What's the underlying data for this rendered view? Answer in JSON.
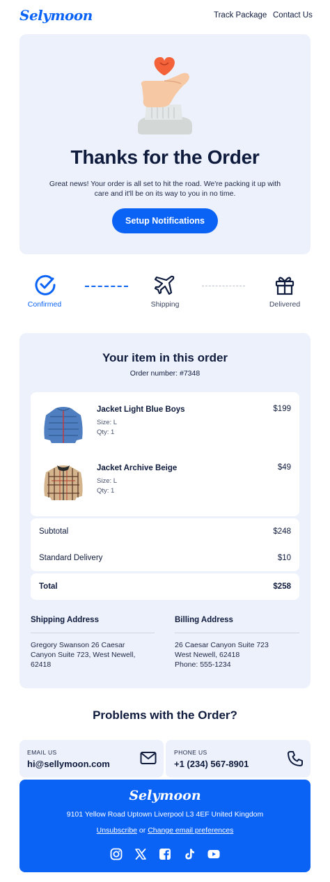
{
  "header": {
    "logo": "Selymoon",
    "nav": [
      "Track Package",
      "Contact Us"
    ]
  },
  "hero": {
    "title": "Thanks for the Order",
    "text": "Great news! Your order is all set to hit the road. We're packing it up with care and it'll be on its way to you in no time.",
    "button": "Setup Notifications"
  },
  "steps": [
    {
      "label": "Confirmed",
      "icon": "check-circle-icon",
      "active": true
    },
    {
      "label": "Shipping",
      "icon": "airplane-icon",
      "active": false
    },
    {
      "label": "Delivered",
      "icon": "gift-icon",
      "active": false
    }
  ],
  "order": {
    "title": "Your item in this order",
    "number": "Order number: #7348",
    "items": [
      {
        "name": "Jacket Light Blue Boys",
        "size": "Size: L",
        "qty": "Qty: 1",
        "price": "$199",
        "image": "blue-puffer-jacket"
      },
      {
        "name": "Jacket Archive Beige",
        "size": "Size: L",
        "qty": "Qty: 1",
        "price": "$49",
        "image": "beige-check-jacket"
      }
    ],
    "subtotal_label": "Subtotal",
    "subtotal": "$248",
    "delivery_label": "Standard Delivery",
    "delivery": "$10",
    "total_label": "Total",
    "total": "$258"
  },
  "shipping": {
    "heading": "Shipping Address",
    "lines": [
      "Gregory Swanson 26 Caesar",
      "Canyon Suite 723, West Newell,",
      "62418"
    ]
  },
  "billing": {
    "heading": "Billing Address",
    "lines": [
      "26 Caesar Canyon Suite 723",
      "West Newell, 62418",
      "Phone: 555-1234"
    ]
  },
  "problems": {
    "title": "Problems with the Order?",
    "email_label": "EMAIL US",
    "email": "hi@sellymoon.com",
    "phone_label": "PHONE US",
    "phone": "+1 (234) 567-8901"
  },
  "footer": {
    "logo": "Selymoon",
    "address": "9101 Yellow Road Uptown Liverpool L3 4EF United Kingdom",
    "unsubscribe": "Unsubscribe",
    "or": " or ",
    "preferences": "Change email preferences",
    "social": [
      "instagram-icon",
      "x-icon",
      "facebook-icon",
      "tiktok-icon",
      "youtube-icon"
    ]
  },
  "colors": {
    "accent": "#0b63f6",
    "panel": "#edf1fb",
    "text": "#0f1b3d",
    "heart": "#f4623a"
  }
}
